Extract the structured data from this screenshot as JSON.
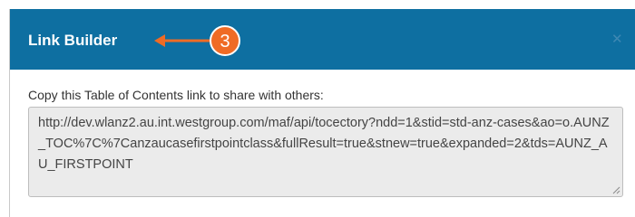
{
  "dialog": {
    "title": "Link Builder",
    "close_icon": "close-icon",
    "callout_number": "3",
    "instruction": "Copy this Table of Contents link to share with others:",
    "link": "http://dev.wlanz2.au.int.westgroup.com/maf/api/tocectory?ndd=1&stid=std-anz-cases&ao=o.AUNZ_TOC%7C%7Canzaucasefirstpointclass&fullResult=true&stnew=true&expanded=2&tds=AUNZ_AU_FIRSTPOINT"
  },
  "colors": {
    "header_bg": "#0e6fa1",
    "callout_orange": "#ef6b25",
    "textarea_bg": "#ebebeb"
  }
}
